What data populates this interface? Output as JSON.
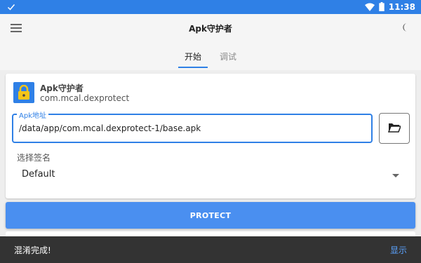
{
  "status_bar": {
    "time": "11:38"
  },
  "app_bar": {
    "title": "Apk守护者"
  },
  "tabs": [
    {
      "label": "开始",
      "active": true
    },
    {
      "label": "调试",
      "active": false
    }
  ],
  "app_info": {
    "name": "Apk守护者",
    "package": "com.mcal.dexprotect"
  },
  "apk_field": {
    "label": "Apk地址",
    "value": "/data/app/com.mcal.dexprotect-1/base.apk"
  },
  "signature": {
    "label": "选择签名",
    "selected": "Default"
  },
  "protect_button": {
    "label": "PROTECT"
  },
  "snackbar": {
    "message": "混淆完成!",
    "action": "显示"
  },
  "colors": {
    "primary": "#2f80e6",
    "button": "#4a8ff0",
    "snackbar": "#333333",
    "snack_action": "#5ba3ff"
  },
  "icons": [
    "check-icon",
    "wifi-icon",
    "battery-icon",
    "menu-icon",
    "moon-icon",
    "lock-icon",
    "folder-open-icon",
    "dropdown-arrow-icon"
  ]
}
